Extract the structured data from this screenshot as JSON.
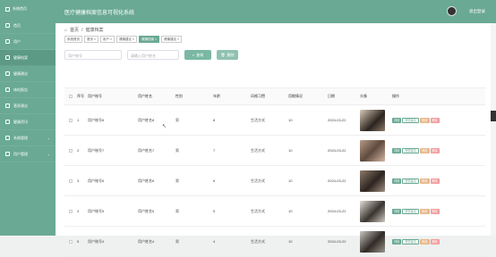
{
  "sidebar": {
    "brand": "系统首页",
    "items": [
      {
        "label": "首页",
        "arrow": ""
      },
      {
        "label": "用户",
        "arrow": ""
      },
      {
        "label": "健康档案",
        "arrow": ""
      },
      {
        "label": "健康建议",
        "arrow": ""
      },
      {
        "label": "体检报告",
        "arrow": ""
      },
      {
        "label": "营养建议",
        "arrow": ""
      },
      {
        "label": "健康资讯",
        "arrow": ""
      },
      {
        "label": "系统管理",
        "arrow": "⌄"
      },
      {
        "label": "用户管理",
        "arrow": "⌄"
      }
    ]
  },
  "topbar": {
    "title": "医疗健康档案信息可视化系统",
    "logout": "退出登录"
  },
  "breadcrumb": {
    "home": "首页",
    "current": "健康档案"
  },
  "tags": [
    "系统首页",
    "首页 ×",
    "用户 ×",
    "健康建议 ×",
    "健康档案 ×",
    "健康建议 ×"
  ],
  "filters": {
    "uid_placeholder": "用户账号",
    "name_placeholder": "请输入用户姓名",
    "query_label": "查询",
    "delete_label": "删除"
  },
  "table": {
    "headers": [
      "序号",
      "用户账号",
      "用户姓名",
      "性别",
      "年龄",
      "风格习惯",
      "用眼情况",
      "日期",
      "头像",
      "操作"
    ],
    "rows": [
      {
        "idx": "1",
        "uid": "用户账号8",
        "name": "用户姓名8",
        "sex": "男",
        "age": "8",
        "habit": "生活方式",
        "sleep": "10",
        "date": "2024-03-22",
        "photo": "p1"
      },
      {
        "idx": "2",
        "uid": "用户账号7",
        "name": "用户姓名7",
        "sex": "男",
        "age": "7",
        "habit": "生活方式",
        "sleep": "10",
        "date": "2024-03-22",
        "photo": "p2"
      },
      {
        "idx": "3",
        "uid": "用户账号6",
        "name": "用户姓名6",
        "sex": "男",
        "age": "6",
        "habit": "生活方式",
        "sleep": "10",
        "date": "2024-03-22",
        "photo": "p3"
      },
      {
        "idx": "4",
        "uid": "用户账号5",
        "name": "用户姓名5",
        "sex": "男",
        "age": "5",
        "habit": "生活方式",
        "sleep": "10",
        "date": "2024-03-22",
        "photo": "p4"
      },
      {
        "idx": "5",
        "uid": "用户账号4",
        "name": "用户姓名4",
        "sex": "男",
        "age": "4",
        "habit": "生活方式",
        "sleep": "10",
        "date": "2024-03-22",
        "photo": "p5"
      }
    ],
    "ops": {
      "detail": "详情",
      "advice": "提供建议",
      "edit": "修改",
      "del": "删除"
    }
  }
}
